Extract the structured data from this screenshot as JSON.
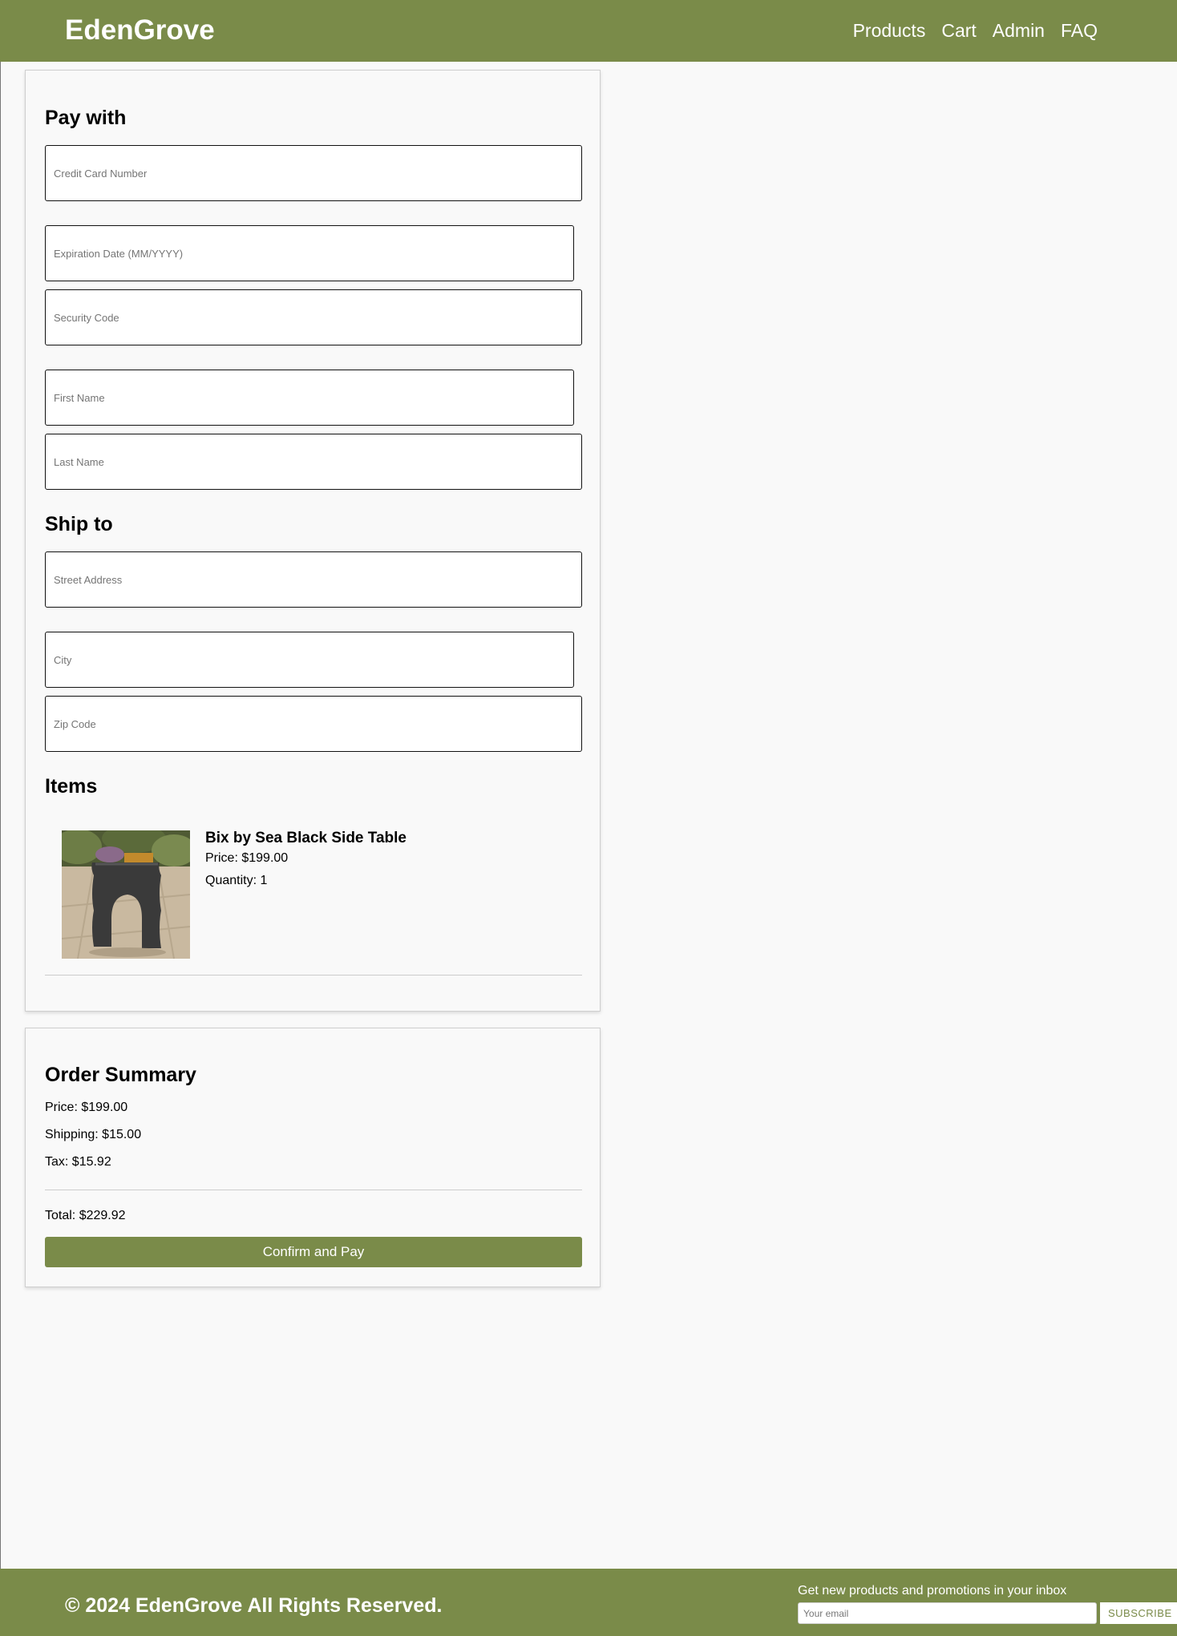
{
  "header": {
    "logo": "EdenGrove",
    "nav": [
      "Products",
      "Cart",
      "Admin",
      "FAQ"
    ]
  },
  "payment": {
    "heading": "Pay with",
    "card_number_placeholder": "Credit Card Number",
    "expiration_placeholder": "Expiration Date (MM/YYYY)",
    "security_code_placeholder": "Security Code",
    "first_name_placeholder": "First Name",
    "last_name_placeholder": "Last Name"
  },
  "shipping": {
    "heading": "Ship to",
    "street_placeholder": "Street Address",
    "city_placeholder": "City",
    "zip_placeholder": "Zip Code"
  },
  "items": {
    "heading": "Items",
    "list": [
      {
        "name": "Bix by Sea Black Side Table",
        "price": "Price: $199.00",
        "quantity": "Quantity: 1"
      }
    ]
  },
  "summary": {
    "heading": "Order Summary",
    "price": "Price: $199.00",
    "shipping": "Shipping: $15.00",
    "tax": "Tax: $15.92",
    "total": "Total: $229.92",
    "confirm_label": "Confirm and Pay"
  },
  "footer": {
    "copyright": "© 2024 EdenGrove All Rights Reserved.",
    "newsletter_text": "Get new products and promotions in your inbox",
    "email_placeholder": "Your email",
    "subscribe_label": "SUBSCRIBE"
  },
  "colors": {
    "brand": "#7a8b49",
    "background": "#f9f9f9"
  }
}
